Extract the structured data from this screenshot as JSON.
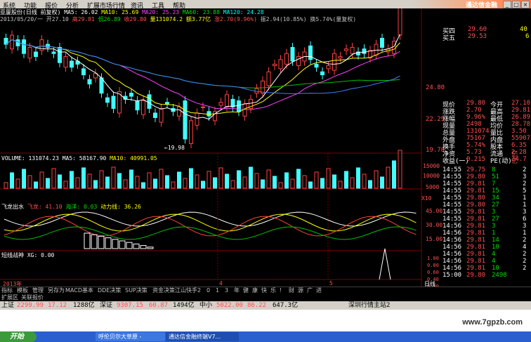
{
  "menu": {
    "items": [
      "系统",
      "功能",
      "报价",
      "分析",
      "扩展市场行情",
      "资讯",
      "工具",
      "帮助"
    ],
    "brand": "通达信金融"
  },
  "info": {
    "title": "亚厦股份(日线 前复权)",
    "ma5": "MA5: 26.02",
    "ma10": "MA10: 25.69",
    "ma20": "MA20: 25.23",
    "ma60": "MA60: 23.88",
    "ma120": "MA120: 24.28",
    "line2_date": "2013/05/20/一 开27.10",
    "line2_high": "高29.81",
    "line2_low": "低26.89",
    "line2_close": "收29.80",
    "line2_vol": "量131074.2",
    "line2_amt": "额3.77亿",
    "line2_chg": "涨2.70(9.96%)",
    "line2_amp": "振2.94(10.85%)",
    "line2_turn": "换5.74%(量复权)"
  },
  "price_axis": [
    "24.80",
    "22.29",
    "19.78"
  ],
  "low_label": "←19.98",
  "volume": {
    "label": "VOLUME: 131074.23",
    "ma5": "MA5: 58167.90",
    "ma10": "MA10: 40991.05",
    "axis": [
      "15000",
      "10000",
      "5000",
      "X10"
    ]
  },
  "indicator1": {
    "name": "飞龙出水",
    "red": "飞龙: 41.10",
    "green": "海洋: 0.03",
    "yellow": "动力线: 36.26",
    "axis": [
      "45.00",
      "30.00",
      "15.00"
    ]
  },
  "indicator2": {
    "name": "短线战神 XG: 0.00",
    "axis": [
      "1.00",
      "0.80",
      "0.60",
      "0.40",
      "0.20",
      "0.00"
    ]
  },
  "xaxis": {
    "year": "2013年",
    "m4": "4",
    "m5": "5",
    "right": "日线"
  },
  "quotes": [
    {
      "label": "买四",
      "value": "29.60",
      "vol": "40"
    },
    {
      "label": "买五",
      "value": "29.53",
      "vol": "6"
    }
  ],
  "stats": [
    {
      "l1": "现价",
      "v1": "29.80",
      "l2": "今开",
      "v2": "27.10"
    },
    {
      "l1": "涨跌",
      "v1": "2.70",
      "l2": "最高",
      "v2": "29.81"
    },
    {
      "l1": "涨幅",
      "v1": "9.96%",
      "l2": "最低",
      "v2": "26.89"
    },
    {
      "l1": "现量",
      "v1": "2498",
      "l2": "均价",
      "v2": "28.78"
    },
    {
      "l1": "总量",
      "v1": "131074",
      "l2": "量比",
      "v2": "3.50"
    },
    {
      "l1": "外盘",
      "v1": "75167",
      "l2": "内盘",
      "v2": "55907"
    },
    {
      "l1": "换手",
      "v1": "5.74%",
      "l2": "股本",
      "v2": "6.35亿"
    },
    {
      "l1": "净资",
      "v1": "5.73",
      "l2": "流通",
      "v2": "2.28亿"
    },
    {
      "l1": "收益(一)",
      "v1": "0.215",
      "l2": "PE(动)",
      "v2": "34.7"
    }
  ],
  "ticks": [
    {
      "t": "14:55",
      "p": "29.75",
      "v": "8",
      "d": "2"
    },
    {
      "t": "14:55",
      "p": "29.80",
      "v": "51",
      "d": "3"
    },
    {
      "t": "14:55",
      "p": "29.81",
      "v": "7",
      "d": "2"
    },
    {
      "t": "14:55",
      "p": "29.81",
      "v": "15",
      "d": "5"
    },
    {
      "t": "14:55",
      "p": "29.80",
      "v": "34",
      "d": "1"
    },
    {
      "t": "14:55",
      "p": "29.80",
      "v": "27",
      "d": "1"
    },
    {
      "t": "14:55",
      "p": "29.81",
      "v": "3",
      "d": "3"
    },
    {
      "t": "14:55",
      "p": "29.81",
      "v": "27",
      "d": "6"
    },
    {
      "t": "14:56",
      "p": "29.81",
      "v": "3",
      "d": "3"
    },
    {
      "t": "14:56",
      "p": "29.81",
      "v": "1",
      "d": "1"
    },
    {
      "t": "14:56",
      "p": "29.81",
      "v": "14",
      "d": "2"
    },
    {
      "t": "14:56",
      "p": "29.81",
      "v": "10",
      "d": "4"
    },
    {
      "t": "14:56",
      "p": "29.81",
      "v": "4",
      "d": "2"
    },
    {
      "t": "14:56",
      "p": "29.81",
      "v": "4",
      "d": "2"
    },
    {
      "t": "14:56",
      "p": "29.81",
      "v": "10",
      "d": "2"
    },
    {
      "t": "15:00",
      "p": "29.80",
      "v": "2498",
      "d": ""
    }
  ],
  "tabs": [
    "指标",
    "模板",
    "管理",
    "另存为",
    "MACD基本",
    "DDE决策",
    "SUP决策",
    "资金决策",
    "江山快手",
    "2",
    "0",
    "1",
    "3",
    "年",
    "健",
    "康",
    "快",
    "乐",
    "!",
    "财",
    "源",
    "广",
    "进"
  ],
  "subtabs": [
    "扩展区",
    "关联报价"
  ],
  "statusbar": {
    "sh_label": "上证",
    "sh_val": "2299.99",
    "sh_chg": "17.12",
    "sh_amt": "1288亿",
    "sz_label": "深证",
    "sz_val": "9307.15",
    "sz_chg": "60.87",
    "sz_amt": "1494亿",
    "zx_label": "中小",
    "zx_val": "5022.00",
    "zx_chg": "86.22",
    "zx_amt": "647.3亿",
    "server": "深圳行情主站2"
  },
  "taskbar": {
    "start": "开始",
    "items": [
      "呼伦贝尔大草原 -",
      "通达信金融终端V7..."
    ]
  },
  "watermark": "www.7gpzb.com"
}
